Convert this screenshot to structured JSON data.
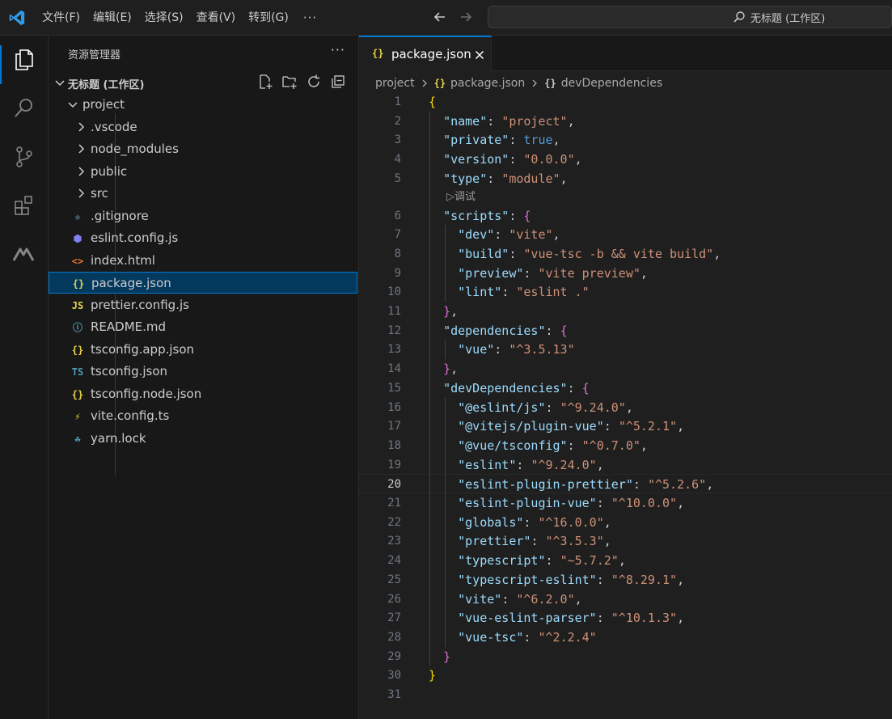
{
  "menu": {
    "items": [
      "文件(F)",
      "编辑(E)",
      "选择(S)",
      "查看(V)",
      "转到(G)"
    ],
    "more": "···"
  },
  "command_center": {
    "text": "无标题 (工作区)"
  },
  "sidebar": {
    "title": "资源管理器",
    "more": "···",
    "workspace_title": "无标题 (工作区)",
    "tree": [
      {
        "label": "project",
        "type": "folder-open",
        "depth": 1,
        "icon": "chevron-down-icon"
      },
      {
        "label": ".vscode",
        "type": "folder",
        "depth": 2,
        "icon": "chevron-right-icon"
      },
      {
        "label": "node_modules",
        "type": "folder",
        "depth": 2,
        "icon": "chevron-right-icon"
      },
      {
        "label": "public",
        "type": "folder",
        "depth": 2,
        "icon": "chevron-right-icon"
      },
      {
        "label": "src",
        "type": "folder",
        "depth": 2,
        "icon": "chevron-right-icon"
      },
      {
        "label": ".gitignore",
        "type": "file",
        "depth": 2,
        "icon": "git-icon",
        "glyph": "◆",
        "color": "#41535b"
      },
      {
        "label": "eslint.config.js",
        "type": "file",
        "depth": 2,
        "icon": "eslint-icon",
        "glyph": "⬢",
        "color": "#8080f2"
      },
      {
        "label": "index.html",
        "type": "file",
        "depth": 2,
        "icon": "html-icon",
        "glyph": "<>",
        "color": "#e37933"
      },
      {
        "label": "package.json",
        "type": "file",
        "depth": 2,
        "icon": "json-icon",
        "glyph": "{}",
        "color": "#e8d44d",
        "selected": true
      },
      {
        "label": "prettier.config.js",
        "type": "file",
        "depth": 2,
        "icon": "javascript-icon",
        "glyph": "JS",
        "color": "#e8d44d"
      },
      {
        "label": "README.md",
        "type": "file",
        "depth": 2,
        "icon": "info-icon",
        "glyph": "ⓘ",
        "color": "#519aba"
      },
      {
        "label": "tsconfig.app.json",
        "type": "file",
        "depth": 2,
        "icon": "json-icon",
        "glyph": "{}",
        "color": "#e8d44d"
      },
      {
        "label": "tsconfig.json",
        "type": "file",
        "depth": 2,
        "icon": "typescript-icon",
        "glyph": "TS",
        "color": "#519aba"
      },
      {
        "label": "tsconfig.node.json",
        "type": "file",
        "depth": 2,
        "icon": "json-icon",
        "glyph": "{}",
        "color": "#e8d44d"
      },
      {
        "label": "vite.config.ts",
        "type": "file",
        "depth": 2,
        "icon": "vite-icon",
        "glyph": "⚡",
        "color": "#e8d44d"
      },
      {
        "label": "yarn.lock",
        "type": "file",
        "depth": 2,
        "icon": "yarn-icon",
        "glyph": "☘",
        "color": "#519aba"
      }
    ]
  },
  "editor": {
    "tab": {
      "icon_glyph": "{}",
      "label": "package.json"
    },
    "breadcrumb": {
      "folder": "project",
      "file_icon": "{}",
      "file": "package.json",
      "symbol_icon": "{}",
      "symbol": "devDependencies"
    },
    "codelens": {
      "text": "▷调试",
      "after_line": 5
    },
    "current_line": 20,
    "lines": [
      {
        "n": "1",
        "tokens": [
          [
            "{",
            "brace1"
          ]
        ]
      },
      {
        "n": "2",
        "tokens": [
          [
            "  ",
            "punc"
          ],
          [
            "\"name\"",
            "key"
          ],
          [
            ": ",
            "punc"
          ],
          [
            "\"project\"",
            "str"
          ],
          [
            ",",
            "punc"
          ]
        ]
      },
      {
        "n": "3",
        "tokens": [
          [
            "  ",
            "punc"
          ],
          [
            "\"private\"",
            "key"
          ],
          [
            ": ",
            "punc"
          ],
          [
            "true",
            "bool"
          ],
          [
            ",",
            "punc"
          ]
        ]
      },
      {
        "n": "4",
        "tokens": [
          [
            "  ",
            "punc"
          ],
          [
            "\"version\"",
            "key"
          ],
          [
            ": ",
            "punc"
          ],
          [
            "\"0.0.0\"",
            "str"
          ],
          [
            ",",
            "punc"
          ]
        ]
      },
      {
        "n": "5",
        "tokens": [
          [
            "  ",
            "punc"
          ],
          [
            "\"type\"",
            "key"
          ],
          [
            ": ",
            "punc"
          ],
          [
            "\"module\"",
            "str"
          ],
          [
            ",",
            "punc"
          ]
        ]
      },
      {
        "n": "6",
        "tokens": [
          [
            "  ",
            "punc"
          ],
          [
            "\"scripts\"",
            "key"
          ],
          [
            ": ",
            "punc"
          ],
          [
            "{",
            "brace2"
          ]
        ]
      },
      {
        "n": "7",
        "tokens": [
          [
            "    ",
            "punc"
          ],
          [
            "\"dev\"",
            "key"
          ],
          [
            ": ",
            "punc"
          ],
          [
            "\"vite\"",
            "str"
          ],
          [
            ",",
            "punc"
          ]
        ]
      },
      {
        "n": "8",
        "tokens": [
          [
            "    ",
            "punc"
          ],
          [
            "\"build\"",
            "key"
          ],
          [
            ": ",
            "punc"
          ],
          [
            "\"vue-tsc -b && vite build\"",
            "str"
          ],
          [
            ",",
            "punc"
          ]
        ]
      },
      {
        "n": "9",
        "tokens": [
          [
            "    ",
            "punc"
          ],
          [
            "\"preview\"",
            "key"
          ],
          [
            ": ",
            "punc"
          ],
          [
            "\"vite preview\"",
            "str"
          ],
          [
            ",",
            "punc"
          ]
        ]
      },
      {
        "n": "10",
        "tokens": [
          [
            "    ",
            "punc"
          ],
          [
            "\"lint\"",
            "key"
          ],
          [
            ": ",
            "punc"
          ],
          [
            "\"eslint .\"",
            "str"
          ]
        ]
      },
      {
        "n": "11",
        "tokens": [
          [
            "  ",
            "punc"
          ],
          [
            "}",
            "brace2"
          ],
          [
            ",",
            "punc"
          ]
        ]
      },
      {
        "n": "12",
        "tokens": [
          [
            "  ",
            "punc"
          ],
          [
            "\"dependencies\"",
            "key"
          ],
          [
            ": ",
            "punc"
          ],
          [
            "{",
            "brace2"
          ]
        ]
      },
      {
        "n": "13",
        "tokens": [
          [
            "    ",
            "punc"
          ],
          [
            "\"vue\"",
            "key"
          ],
          [
            ": ",
            "punc"
          ],
          [
            "\"^3.5.13\"",
            "str"
          ]
        ]
      },
      {
        "n": "14",
        "tokens": [
          [
            "  ",
            "punc"
          ],
          [
            "}",
            "brace2"
          ],
          [
            ",",
            "punc"
          ]
        ]
      },
      {
        "n": "15",
        "tokens": [
          [
            "  ",
            "punc"
          ],
          [
            "\"devDependencies\"",
            "key"
          ],
          [
            ": ",
            "punc"
          ],
          [
            "{",
            "brace2"
          ]
        ]
      },
      {
        "n": "16",
        "tokens": [
          [
            "    ",
            "punc"
          ],
          [
            "\"@eslint/js\"",
            "key"
          ],
          [
            ": ",
            "punc"
          ],
          [
            "\"^9.24.0\"",
            "str"
          ],
          [
            ",",
            "punc"
          ]
        ]
      },
      {
        "n": "17",
        "tokens": [
          [
            "    ",
            "punc"
          ],
          [
            "\"@vitejs/plugin-vue\"",
            "key"
          ],
          [
            ": ",
            "punc"
          ],
          [
            "\"^5.2.1\"",
            "str"
          ],
          [
            ",",
            "punc"
          ]
        ]
      },
      {
        "n": "18",
        "tokens": [
          [
            "    ",
            "punc"
          ],
          [
            "\"@vue/tsconfig\"",
            "key"
          ],
          [
            ": ",
            "punc"
          ],
          [
            "\"^0.7.0\"",
            "str"
          ],
          [
            ",",
            "punc"
          ]
        ]
      },
      {
        "n": "19",
        "tokens": [
          [
            "    ",
            "punc"
          ],
          [
            "\"eslint\"",
            "key"
          ],
          [
            ": ",
            "punc"
          ],
          [
            "\"^9.24.0\"",
            "str"
          ],
          [
            ",",
            "punc"
          ]
        ]
      },
      {
        "n": "20",
        "tokens": [
          [
            "    ",
            "punc"
          ],
          [
            "\"eslint-plugin-prettier\"",
            "key"
          ],
          [
            ": ",
            "punc"
          ],
          [
            "\"^5.2.6\"",
            "str"
          ],
          [
            ",",
            "punc"
          ]
        ]
      },
      {
        "n": "21",
        "tokens": [
          [
            "    ",
            "punc"
          ],
          [
            "\"eslint-plugin-vue\"",
            "key"
          ],
          [
            ": ",
            "punc"
          ],
          [
            "\"^10.0.0\"",
            "str"
          ],
          [
            ",",
            "punc"
          ]
        ]
      },
      {
        "n": "22",
        "tokens": [
          [
            "    ",
            "punc"
          ],
          [
            "\"globals\"",
            "key"
          ],
          [
            ": ",
            "punc"
          ],
          [
            "\"^16.0.0\"",
            "str"
          ],
          [
            ",",
            "punc"
          ]
        ]
      },
      {
        "n": "23",
        "tokens": [
          [
            "    ",
            "punc"
          ],
          [
            "\"prettier\"",
            "key"
          ],
          [
            ": ",
            "punc"
          ],
          [
            "\"^3.5.3\"",
            "str"
          ],
          [
            ",",
            "punc"
          ]
        ]
      },
      {
        "n": "24",
        "tokens": [
          [
            "    ",
            "punc"
          ],
          [
            "\"typescript\"",
            "key"
          ],
          [
            ": ",
            "punc"
          ],
          [
            "\"~5.7.2\"",
            "str"
          ],
          [
            ",",
            "punc"
          ]
        ]
      },
      {
        "n": "25",
        "tokens": [
          [
            "    ",
            "punc"
          ],
          [
            "\"typescript-eslint\"",
            "key"
          ],
          [
            ": ",
            "punc"
          ],
          [
            "\"^8.29.1\"",
            "str"
          ],
          [
            ",",
            "punc"
          ]
        ]
      },
      {
        "n": "26",
        "tokens": [
          [
            "    ",
            "punc"
          ],
          [
            "\"vite\"",
            "key"
          ],
          [
            ": ",
            "punc"
          ],
          [
            "\"^6.2.0\"",
            "str"
          ],
          [
            ",",
            "punc"
          ]
        ]
      },
      {
        "n": "27",
        "tokens": [
          [
            "    ",
            "punc"
          ],
          [
            "\"vue-eslint-parser\"",
            "key"
          ],
          [
            ": ",
            "punc"
          ],
          [
            "\"^10.1.3\"",
            "str"
          ],
          [
            ",",
            "punc"
          ]
        ]
      },
      {
        "n": "28",
        "tokens": [
          [
            "    ",
            "punc"
          ],
          [
            "\"vue-tsc\"",
            "key"
          ],
          [
            ": ",
            "punc"
          ],
          [
            "\"^2.2.4\"",
            "str"
          ]
        ]
      },
      {
        "n": "29",
        "tokens": [
          [
            "  ",
            "punc"
          ],
          [
            "}",
            "brace2"
          ]
        ]
      },
      {
        "n": "30",
        "tokens": [
          [
            "}",
            "brace1"
          ]
        ]
      },
      {
        "n": "31",
        "tokens": []
      }
    ]
  },
  "colors": {
    "accent": "#0078d4",
    "selected_bg": "#04395e"
  }
}
